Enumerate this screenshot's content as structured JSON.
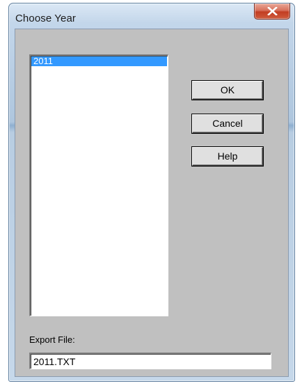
{
  "window": {
    "title": "Choose Year"
  },
  "year_list": {
    "items": [
      "2011"
    ],
    "selected": "2011"
  },
  "buttons": {
    "ok_label": "OK",
    "cancel_label": "Cancel",
    "help_label": "Help"
  },
  "export": {
    "label": "Export File:",
    "value": "2011.TXT"
  },
  "colors": {
    "selection_bg": "#3399ff",
    "dialog_bg": "#c0c0c0",
    "close_button": "#c94a2e"
  },
  "icons": {
    "close": "close-icon"
  }
}
